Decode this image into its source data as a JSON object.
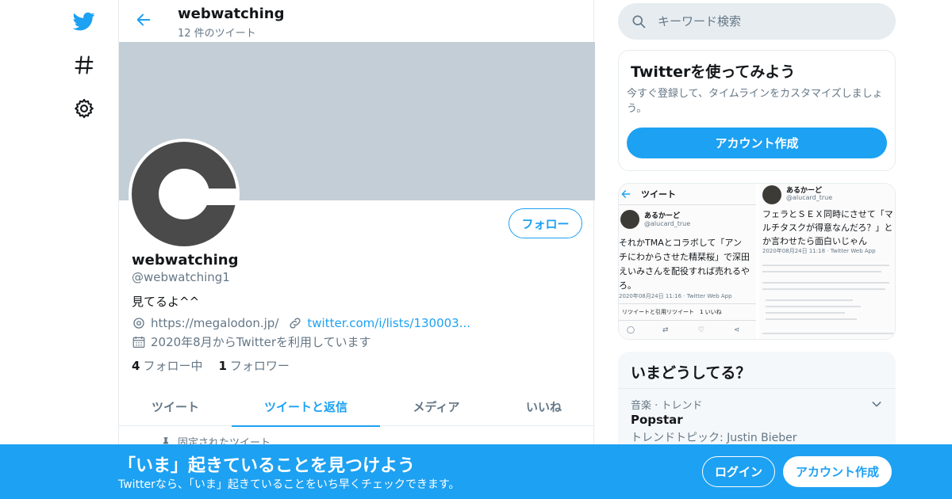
{
  "colors": {
    "accent": "#1da1f2",
    "banner": "#c4ced6",
    "muted_text": "#657786",
    "primary_text": "#14171a",
    "avatar_fill": "#4a4a4a"
  },
  "nav": {
    "items": [
      {
        "icon": "twitter-bird-icon"
      },
      {
        "icon": "hashtag-icon"
      },
      {
        "icon": "gear-icon"
      }
    ]
  },
  "header": {
    "title": "webwatching",
    "tweet_count": "12 件のツイート",
    "back_icon": "arrow-left-icon"
  },
  "profile": {
    "name": "webwatching",
    "handle": "@webwatching1",
    "bio": "見てるよ^^",
    "location": "https://megalodon.jp/",
    "link": "twitter.com/i/lists/130003...",
    "joined": "2020年8月からTwitterを利用しています",
    "following_count": "4",
    "following_label": "フォロー中",
    "followers_count": "1",
    "followers_label": "フォロワー",
    "follow_button": "フォロー"
  },
  "tabs": [
    {
      "label": "ツイート",
      "active": false
    },
    {
      "label": "ツイートと返信",
      "active": true
    },
    {
      "label": "メディア",
      "active": false
    },
    {
      "label": "いいね",
      "active": false
    }
  ],
  "pinned_label": "固定されたツイート",
  "search": {
    "placeholder": "キーワード検索"
  },
  "signup_card": {
    "title": "Twitterを使ってみよう",
    "description": "今すぐ登録して、タイムラインをカスタマイズしましょう。",
    "button": "アカウント作成"
  },
  "media_card": {
    "left": {
      "header": "ツイート",
      "user_name": "あるかーど",
      "user_handle": "@alucard_true",
      "text_lines": [
        "それかTMAとコラボして「アン",
        "チにわからさせた精栞桜」で深田",
        "えいみさんを配役すれば売れるや",
        "ろ。"
      ],
      "timestamp": "2020年08月24日 11:16 · Twitter Web App",
      "stats": "リツイートと引用リツイート　1 いいね"
    },
    "right": {
      "user_name": "あるかーど",
      "user_handle": "@alucard_true",
      "text_lines": [
        "フェラとＳＥＸ同時にさせて「マ",
        "ルチタスクが得意なんだろ？」と",
        "か言わせたら面白いじゃん"
      ],
      "timestamp": "2020年08月24日 11:18 · Twitter Web App"
    }
  },
  "trends": {
    "title": "いまどうしてる？",
    "items": [
      {
        "category": "音楽 · トレンド",
        "name": "Popstar",
        "topic": "トレンドトピック: Justin Bieber"
      }
    ]
  },
  "bottom_bar": {
    "title": "「いま」起きていることを見つけよう",
    "subtitle": "Twitterなら、「いま」起きていることをいち早くチェックできます。",
    "login": "ログイン",
    "signup": "アカウント作成"
  }
}
